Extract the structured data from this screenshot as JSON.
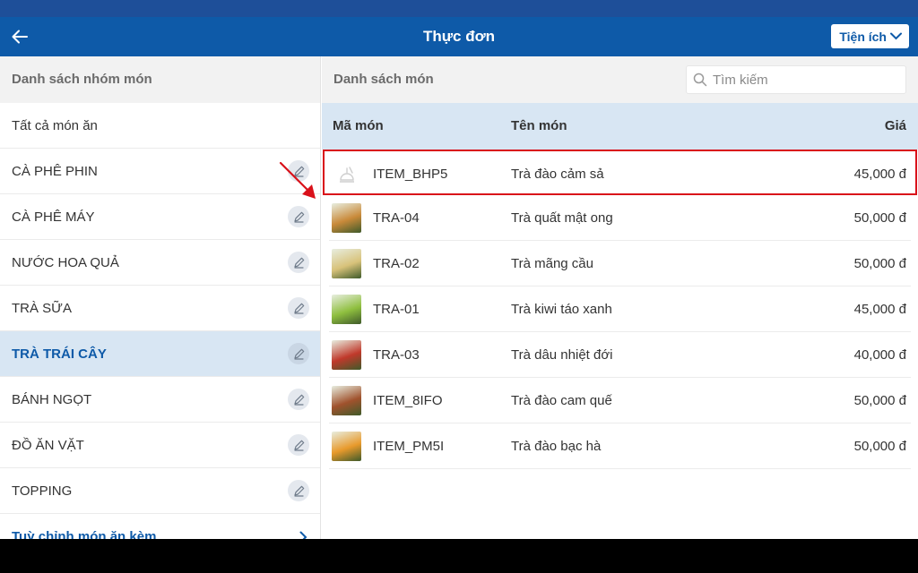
{
  "header": {
    "title": "Thực đơn",
    "utility_label": "Tiện ích"
  },
  "left_panel": {
    "title": "Danh sách nhóm món",
    "groups": [
      {
        "label": "Tất cả món ăn",
        "editable": false,
        "active": false
      },
      {
        "label": "CÀ PHÊ PHIN",
        "editable": true,
        "active": false
      },
      {
        "label": "CÀ PHÊ MÁY",
        "editable": true,
        "active": false
      },
      {
        "label": "NƯỚC HOA QUẢ",
        "editable": true,
        "active": false
      },
      {
        "label": "TRÀ SỮA",
        "editable": true,
        "active": false
      },
      {
        "label": "TRÀ TRÁI CÂY",
        "editable": true,
        "active": true
      },
      {
        "label": "BÁNH NGỌT",
        "editable": true,
        "active": false
      },
      {
        "label": "ĐỒ ĂN VẶT",
        "editable": true,
        "active": false
      },
      {
        "label": "TOPPING",
        "editable": true,
        "active": false
      }
    ],
    "custom_link": "Tuỳ chỉnh món ăn kèm"
  },
  "right_panel": {
    "title": "Danh sách món",
    "search_placeholder": "Tìm kiếm",
    "columns": {
      "code": "Mã món",
      "name": "Tên món",
      "price": "Giá"
    },
    "items": [
      {
        "code": "ITEM_BHP5",
        "name": "Trà đào cảm sả",
        "price": "45,000 đ",
        "thumb": "placeholder",
        "highlight": true
      },
      {
        "code": "TRA-04",
        "name": "Trà quất mật ong",
        "price": "50,000 đ",
        "thumb": "#c98a3a",
        "highlight": false
      },
      {
        "code": "TRA-02",
        "name": "Trà mãng cầu",
        "price": "50,000 đ",
        "thumb": "#d8c27a",
        "highlight": false
      },
      {
        "code": "TRA-01",
        "name": "Trà kiwi táo xanh",
        "price": "45,000 đ",
        "thumb": "#8fbf3f",
        "highlight": false
      },
      {
        "code": "TRA-03",
        "name": "Trà dâu nhiệt đới",
        "price": "40,000 đ",
        "thumb": "#c0392b",
        "highlight": false
      },
      {
        "code": "ITEM_8IFO",
        "name": "Trà đào cam quế",
        "price": "50,000 đ",
        "thumb": "#a0522d",
        "highlight": false
      },
      {
        "code": "ITEM_PM5I",
        "name": "Trà đào bạc hà",
        "price": "50,000 đ",
        "thumb": "#e89a2c",
        "highlight": false
      }
    ]
  },
  "colors": {
    "primary": "#0e5aa8",
    "highlight_border": "#d9111a",
    "active_bg": "#d8e6f3"
  }
}
